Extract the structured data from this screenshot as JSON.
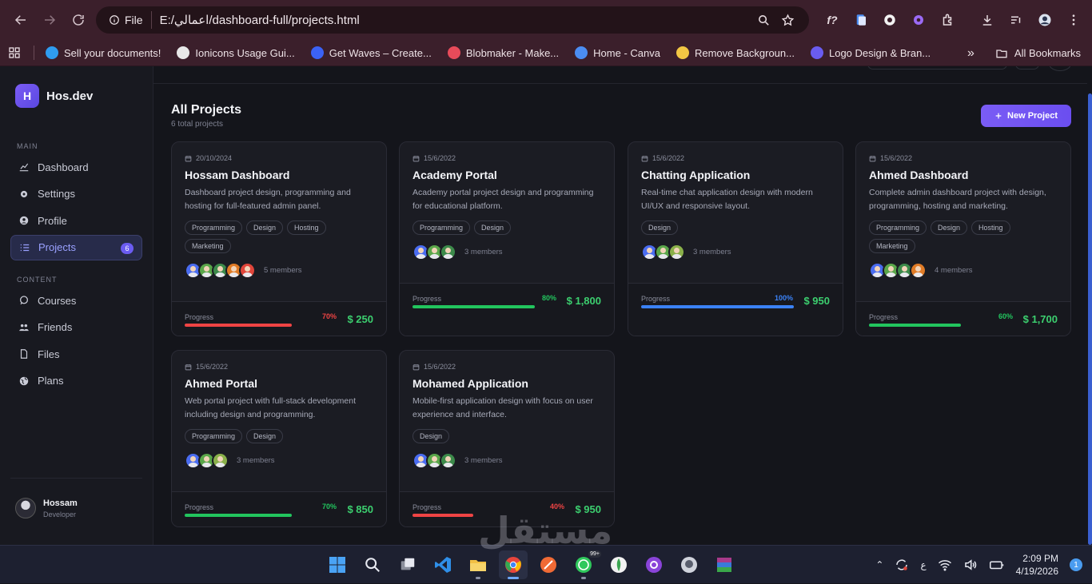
{
  "browser": {
    "file_label": "File",
    "url": "E:/اعمالي/dashboard-full/projects.html",
    "bookmarks": [
      {
        "label": "Sell your documents!",
        "color": "#2f9cf0"
      },
      {
        "label": "Ionicons Usage Gui...",
        "color": "#e8e8e8"
      },
      {
        "label": "Get Waves – Create...",
        "color": "#3b62f5"
      },
      {
        "label": "Blobmaker - Make...",
        "color": "#e84b5a"
      },
      {
        "label": "Home - Canva",
        "color": "#4b8df2"
      },
      {
        "label": "Remove Backgroun...",
        "color": "#f2c744"
      },
      {
        "label": "Logo Design & Bran...",
        "color": "#6a5cf0"
      }
    ],
    "overflow_label": "»",
    "all_bookmarks_label": "All Bookmarks"
  },
  "sidebar": {
    "brand_letter": "H",
    "brand_name": "Hos.dev",
    "main_label": "MAIN",
    "content_label": "CONTENT",
    "items_main": [
      {
        "label": "Dashboard",
        "icon": "chart-icon"
      },
      {
        "label": "Settings",
        "icon": "gear-icon"
      },
      {
        "label": "Profile",
        "icon": "user-icon"
      },
      {
        "label": "Projects",
        "icon": "list-icon",
        "badge": "6",
        "active": true
      }
    ],
    "items_content": [
      {
        "label": "Courses",
        "icon": "chat-icon"
      },
      {
        "label": "Friends",
        "icon": "users-icon"
      },
      {
        "label": "Files",
        "icon": "file-icon"
      },
      {
        "label": "Plans",
        "icon": "globe-icon"
      }
    ],
    "user": {
      "name": "Hossam",
      "role": "Developer"
    }
  },
  "page": {
    "title": "All Projects",
    "subtitle": "6 total projects",
    "new_button": "New Project"
  },
  "projects": [
    {
      "date": "20/10/2024",
      "title": "Hossam Dashboard",
      "desc": "Dashboard project design, programming and hosting for full-featured admin panel.",
      "tags": [
        "Programming",
        "Design",
        "Hosting",
        "Marketing"
      ],
      "avatars": [
        "#4a6cf0",
        "#5aa64a",
        "#3c8a4a",
        "#e07b26",
        "#e0453a"
      ],
      "members": "5 members",
      "progress_label": "Progress",
      "progress_pct": "70%",
      "progress": 0.7,
      "color": "#ef4444",
      "price": "$ 250"
    },
    {
      "date": "15/6/2022",
      "title": "Academy Portal",
      "desc": "Academy portal project design and programming for educational platform.",
      "tags": [
        "Programming",
        "Design"
      ],
      "avatars": [
        "#4a6cf0",
        "#5aa64a",
        "#3c8a4a"
      ],
      "members": "3 members",
      "progress_label": "Progress",
      "progress_pct": "80%",
      "progress": 0.8,
      "color": "#22c55e",
      "price": "$ 1,800"
    },
    {
      "date": "15/6/2022",
      "title": "Chatting Application",
      "desc": "Real-time chat application design with modern UI/UX and responsive layout.",
      "tags": [
        "Design"
      ],
      "avatars": [
        "#4a6cf0",
        "#5aa64a",
        "#8ab04a"
      ],
      "members": "3 members",
      "progress_label": "Progress",
      "progress_pct": "100%",
      "progress": 1.0,
      "color": "#3b82f6",
      "price": "$ 950"
    },
    {
      "date": "15/6/2022",
      "title": "Ahmed Dashboard",
      "desc": "Complete admin dashboard project with design, programming, hosting and marketing.",
      "tags": [
        "Programming",
        "Design",
        "Hosting",
        "Marketing"
      ],
      "avatars": [
        "#4a6cf0",
        "#5aa64a",
        "#3c8a4a",
        "#e07b26"
      ],
      "members": "4 members",
      "progress_label": "Progress",
      "progress_pct": "60%",
      "progress": 0.6,
      "color": "#22c55e",
      "price": "$ 1,700"
    },
    {
      "date": "15/6/2022",
      "title": "Ahmed Portal",
      "desc": "Web portal project with full-stack development including design and programming.",
      "tags": [
        "Programming",
        "Design"
      ],
      "avatars": [
        "#4a6cf0",
        "#5aa64a",
        "#8ab04a"
      ],
      "members": "3 members",
      "progress_label": "Progress",
      "progress_pct": "70%",
      "progress": 0.7,
      "color": "#22c55e",
      "price": "$ 850"
    },
    {
      "date": "15/6/2022",
      "title": "Mohamed Application",
      "desc": "Mobile-first application design with focus on user experience and interface.",
      "tags": [
        "Design"
      ],
      "avatars": [
        "#4a6cf0",
        "#5aa64a",
        "#3c8a4a"
      ],
      "members": "3 members",
      "progress_label": "Progress",
      "progress_pct": "40%",
      "progress": 0.4,
      "color": "#ef4444",
      "price": "$ 950"
    }
  ],
  "taskbar": {
    "time": "2:09 PM",
    "date": "4/19/2026",
    "lang": "ع",
    "notif_count": "1",
    "badge_99": "99+",
    "watermark": "مستقل"
  }
}
